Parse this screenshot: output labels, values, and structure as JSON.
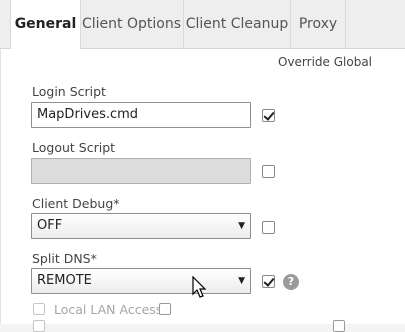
{
  "tabs": [
    {
      "label": "General",
      "active": true
    },
    {
      "label": "Client Options",
      "active": false
    },
    {
      "label": "Client Cleanup",
      "active": false
    },
    {
      "label": "Proxy",
      "active": false
    }
  ],
  "override_global": "Override Global",
  "fields": {
    "login_script": {
      "label": "Login Script",
      "value": "MapDrives.cmd",
      "override_checked": true
    },
    "logout_script": {
      "label": "Logout Script",
      "value": "",
      "disabled": true,
      "override_checked": false
    },
    "client_debug": {
      "label": "Client Debug*",
      "value": "OFF",
      "override_checked": false
    },
    "split_dns": {
      "label": "Split DNS*",
      "value": "REMOTE",
      "override_checked": true
    }
  },
  "local_lan_access": {
    "label": "Local LAN Access",
    "checked": false,
    "disabled": true
  },
  "icons": {
    "help": "question-circle-icon",
    "dropdown": "caret-down-icon",
    "cursor": "mouse-pointer-icon"
  },
  "colors": {
    "tab_bar": "#eeeeee",
    "disabled_field": "#dcdcdc",
    "help_icon": "#9b9b9b"
  }
}
